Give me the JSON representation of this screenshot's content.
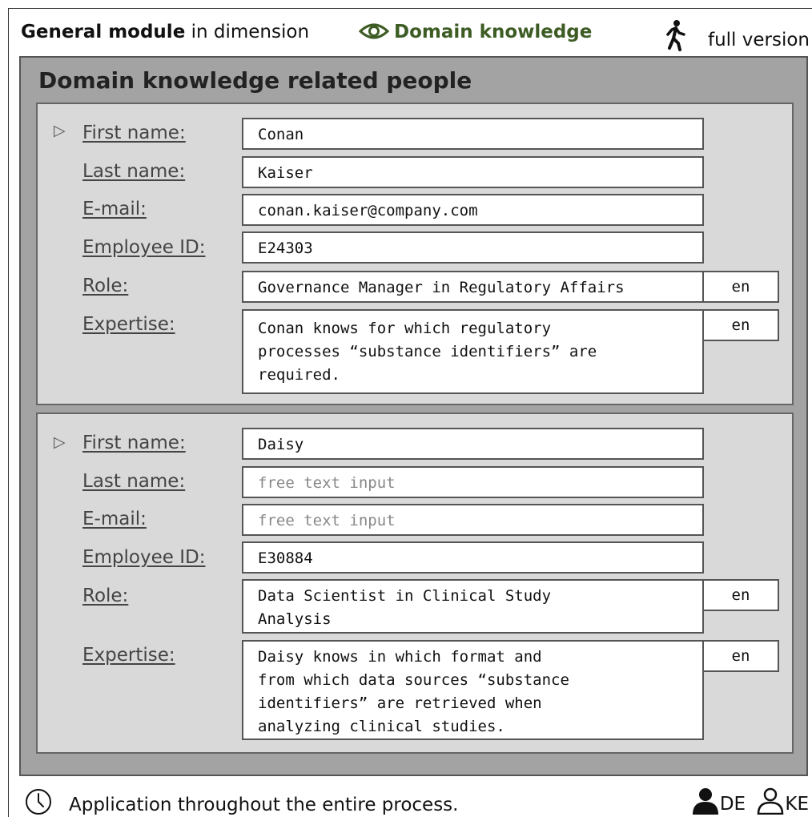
{
  "header": {
    "module_bold": "General module",
    "module_rest": " in dimension",
    "domain_label": "Domain knowledge",
    "domain_icon": "eye-icon",
    "version_label": "full version",
    "version_icon": "walking-person-icon",
    "accent_color": "#3d5c24"
  },
  "panel": {
    "title": "Domain knowledge related people"
  },
  "people": [
    {
      "first_name_label": "First name:",
      "first_name": "Conan",
      "last_name_label": "Last name:",
      "last_name": "Kaiser",
      "email_label": "E-mail:",
      "email": "conan.kaiser@company.com",
      "employee_id_label": "Employee ID:",
      "employee_id": "E24303",
      "role_label": "Role:",
      "role": "Governance Manager in Regulatory Affairs",
      "role_lang": "en",
      "expertise_label": "Expertise:",
      "expertise": "Conan knows for which regulatory\nprocesses “substance identifiers” are\nrequired.",
      "expertise_lang": "en"
    },
    {
      "first_name_label": "First name:",
      "first_name": "Daisy",
      "last_name_label": "Last name:",
      "last_name_placeholder": "free text input",
      "email_label": "E-mail:",
      "email_placeholder": "free text input",
      "employee_id_label": "Employee ID:",
      "employee_id": "E30884",
      "role_label": "Role:",
      "role": "Data Scientist in Clinical Study\nAnalysis",
      "role_lang": "en",
      "expertise_label": "Expertise:",
      "expertise": "Daisy knows in which format and\nfrom which data sources “substance\nidentifiers” are retrieved when\nanalyzing clinical studies.",
      "expertise_lang": "en"
    }
  ],
  "footer": {
    "note": "Application throughout the entire process.",
    "note_icon": "clock-icon",
    "lang_de": "DE",
    "lang_de_icon": "person-filled-icon",
    "lang_ke": "KE",
    "lang_ke_icon": "person-outline-icon"
  }
}
